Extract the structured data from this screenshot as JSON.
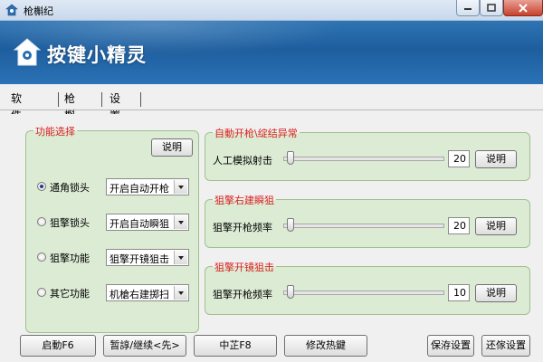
{
  "window": {
    "title": "枪槲纪"
  },
  "banner": {
    "logo_text": "按键小精灵"
  },
  "tabs": [
    {
      "label": "软件说明"
    },
    {
      "label": "枪槲纪"
    },
    {
      "label": "设置"
    }
  ],
  "function_group": {
    "title": "功能选择",
    "help_button": "说明",
    "options": [
      {
        "label": "通角锁头",
        "checked": true,
        "select_value": "开启自动开枪"
      },
      {
        "label": "狙擎锁头",
        "checked": false,
        "select_value": "开启自动瞬狙"
      },
      {
        "label": "狙擎功能",
        "checked": false,
        "select_value": "狙擎开镜狙击"
      },
      {
        "label": "其它功能",
        "checked": false,
        "select_value": "机槍右建掷扫"
      }
    ]
  },
  "slider_groups": [
    {
      "title": "自動开枪\\绽结异常",
      "label": "人工模拟射击",
      "value": "20",
      "button": "说明"
    },
    {
      "title": "狙擎右建瞬狙",
      "label": "狙擎开枪频率",
      "value": "20",
      "button": "说明"
    },
    {
      "title": "狙擎开镜狙击",
      "label": "狙擎开枪频率",
      "value": "10",
      "button": "说明"
    }
  ],
  "bottom_buttons": {
    "start": "启動F6",
    "pause": "暂諄/继续<先>",
    "stop": "中芷F8",
    "hotkey": "修改热鍵",
    "save": "保洊设置",
    "restore": "还傢设置"
  },
  "colors": {
    "banner": "#1e5e9e",
    "group_bg": "#dcebd4",
    "group_title": "#d9201e"
  }
}
